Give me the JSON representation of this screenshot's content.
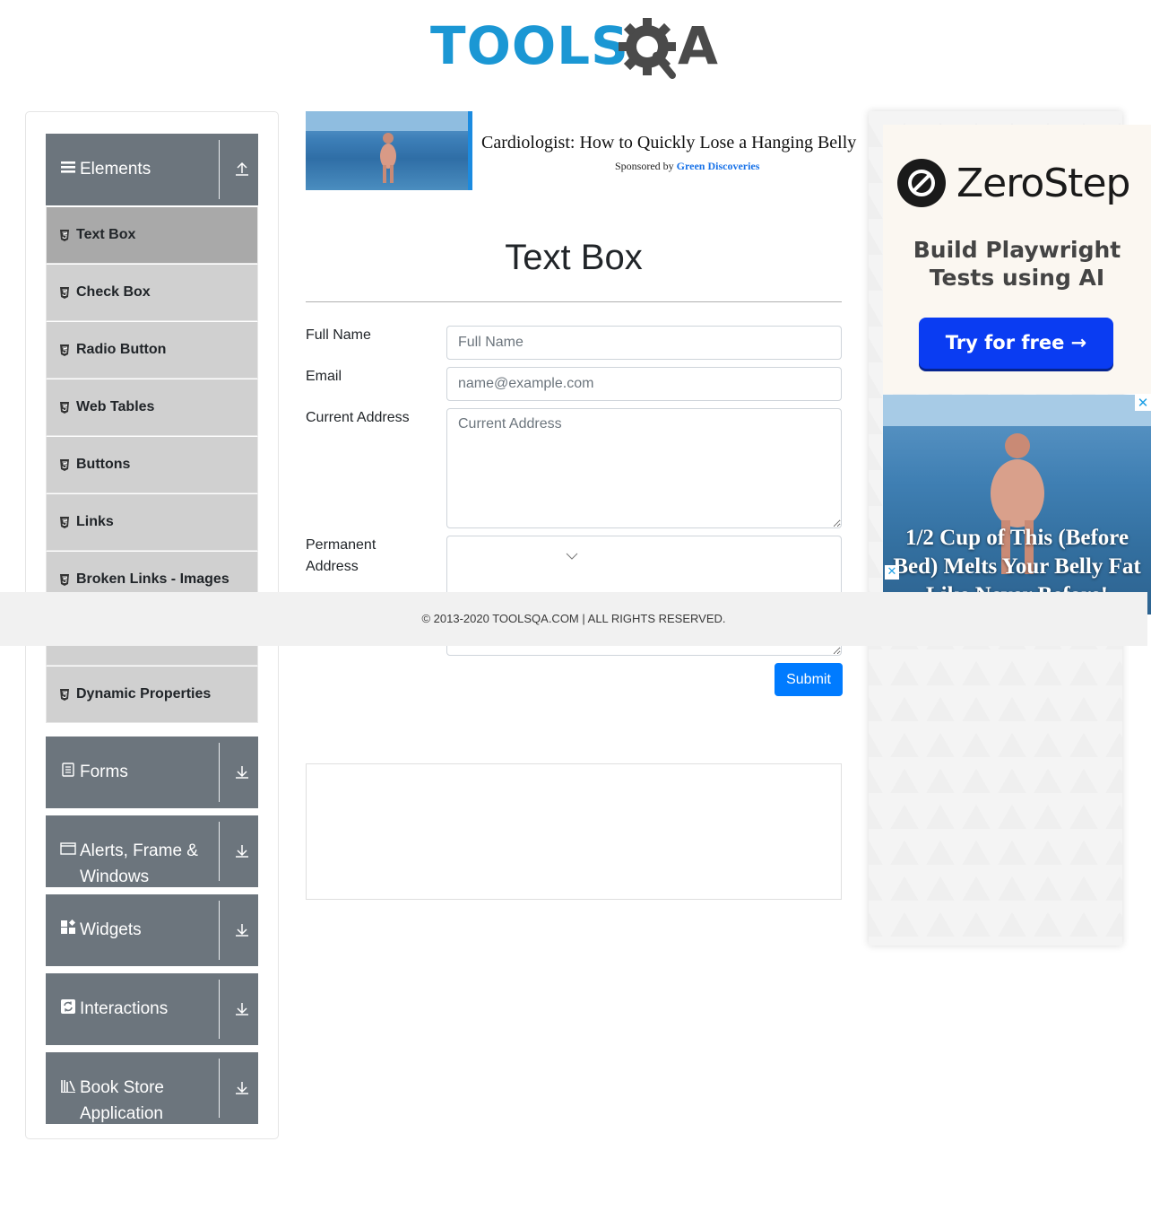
{
  "logo": {
    "text_left": "TOOLS",
    "text_right": "A"
  },
  "nav": {
    "elements_group": {
      "title": "Elements"
    },
    "menu_items": [
      {
        "label": "Text Box"
      },
      {
        "label": "Check Box"
      },
      {
        "label": "Radio Button"
      },
      {
        "label": "Web Tables"
      },
      {
        "label": "Buttons"
      },
      {
        "label": "Links"
      },
      {
        "label": "Broken Links - Images"
      },
      {
        "label": ""
      },
      {
        "label": "Dynamic Properties"
      }
    ],
    "groups": [
      {
        "title": "Forms"
      },
      {
        "title": "Alerts, Frame & Windows"
      },
      {
        "title": "Widgets"
      },
      {
        "title": "Interactions"
      },
      {
        "title": "Book Store Application"
      }
    ]
  },
  "top_ad": {
    "headline": "Cardiologist: How to Quickly Lose a Hanging Belly",
    "sponsored_prefix": "Sponsored by",
    "sponsor": "Green Discoveries"
  },
  "main": {
    "title": "Text Box",
    "form": {
      "full_name_label": "Full Name",
      "full_name_placeholder": "Full Name",
      "email_label": "Email",
      "email_placeholder": "name@example.com",
      "current_address_label": "Current Address",
      "current_address_placeholder": "Current Address",
      "permanent_address_label": "Permanent Address",
      "submit_label": "Submit"
    }
  },
  "right_ad": {
    "brand": "ZeroStep",
    "tagline": "Build Playwright Tests using AI",
    "cta": "Try for free →",
    "beach_text": "1/2 Cup of This (Before Bed) Melts Your Belly Fat Like Never Before!",
    "close_symbol": "✕"
  },
  "footer": {
    "text": "© 2013-2020 TOOLSQA.COM | ALL RIGHTS RESERVED."
  },
  "colors": {
    "brand_blue": "#1b97d4",
    "nav_group": "#6c757d",
    "submit": "#007bff",
    "cta_blue": "#0a3cf2"
  }
}
